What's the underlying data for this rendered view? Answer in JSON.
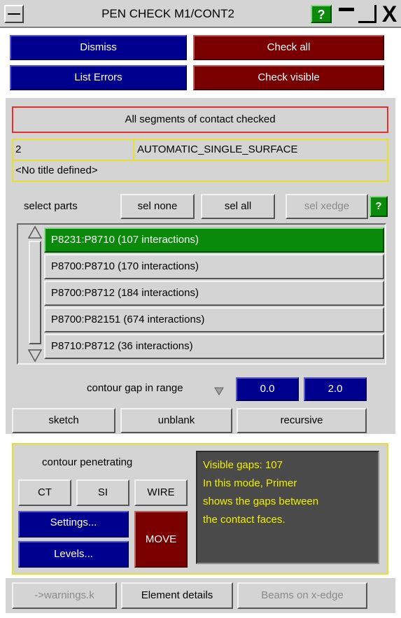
{
  "window": {
    "title": "PEN CHECK M1/CONT2",
    "help_glyph": "?",
    "close_glyph": "X",
    "icons": [
      "minimize-icon",
      "help-icon",
      "maximize-icon",
      "close-icon"
    ]
  },
  "top_buttons": {
    "dismiss": "Dismiss",
    "check_all": "Check all",
    "list_errors": "List Errors",
    "check_visible": "Check visible"
  },
  "status": "All segments of contact checked",
  "contact": {
    "id": "2",
    "type": "AUTOMATIC_SINGLE_SURFACE",
    "title": "<No title defined>"
  },
  "select_parts": {
    "label": "select parts",
    "sel_none": "sel none",
    "sel_all": "sel all",
    "sel_xedge": "sel xedge",
    "help": "?"
  },
  "parts": [
    {
      "label": "P8231:P8710 (107 interactions)",
      "selected": true
    },
    {
      "label": "P8700:P8710 (170 interactions)",
      "selected": false
    },
    {
      "label": "P8700:P8712 (184 interactions)",
      "selected": false
    },
    {
      "label": "P8700:P82151 (674 interactions)",
      "selected": false
    },
    {
      "label": "P8710:P8712 (36 interactions)",
      "selected": false
    }
  ],
  "contour_gap": {
    "label": "contour gap in range",
    "min": "0.0",
    "max": "2.0"
  },
  "actions": {
    "sketch": "sketch",
    "unblank": "unblank",
    "recursive": "recursive"
  },
  "penetrating": {
    "label": "contour penetrating",
    "ct": "CT",
    "si": "SI",
    "wire": "WIRE",
    "settings": "Settings...",
    "levels": "Levels...",
    "move": "MOVE"
  },
  "info": {
    "line1": "Visible gaps: 107",
    "line2": "In this mode, Primer",
    "line3": "shows the gaps between",
    "line4": "the contact faces."
  },
  "bottom": {
    "warnings": "->warnings.k",
    "element_details": "Element details",
    "beams": "Beams on x-edge"
  },
  "colors": {
    "blue_button": "#00008e",
    "red_button": "#7a0000",
    "selected_row": "#0a8a0a",
    "panel": "#d4d4d4",
    "info_text": "#f0f000"
  }
}
